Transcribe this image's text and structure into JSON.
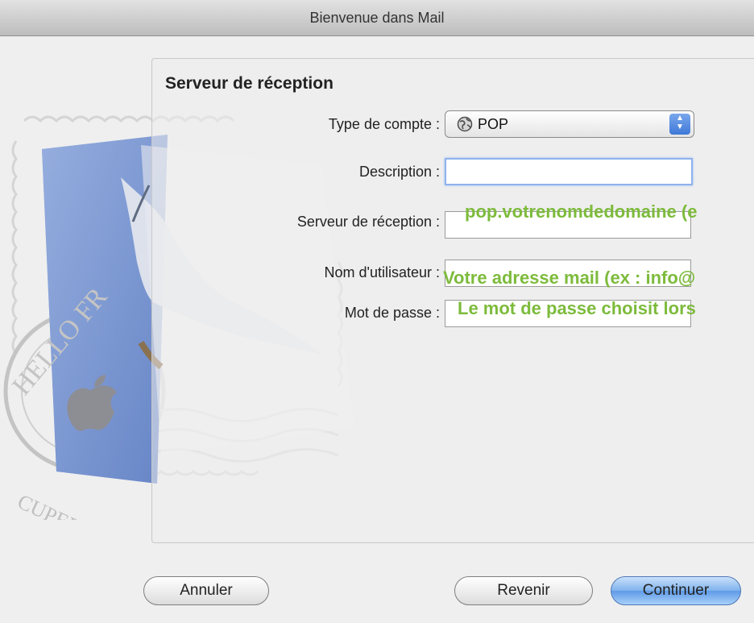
{
  "window": {
    "title": "Bienvenue dans Mail"
  },
  "form": {
    "section_title": "Serveur de réception",
    "account_type": {
      "label": "Type de compte :",
      "value": "POP"
    },
    "description": {
      "label": "Description :",
      "value": ""
    },
    "incoming_server": {
      "label": "Serveur de réception :",
      "hint": "pop.votrenomdedomaine (e"
    },
    "username": {
      "label": "Nom d'utilisateur :",
      "hint": "Votre adresse mail (ex : info@"
    },
    "password": {
      "label": "Mot de passe :",
      "hint": "Le mot de passe choisit lors"
    }
  },
  "stamp": {
    "text_top": "HELLO FR",
    "text_bottom": "CUPERTINO CA"
  },
  "buttons": {
    "cancel": "Annuler",
    "back": "Revenir",
    "continue": "Continuer"
  },
  "colors": {
    "hint_green": "#7dbb3c",
    "focus_blue": "#8fb2ec"
  }
}
